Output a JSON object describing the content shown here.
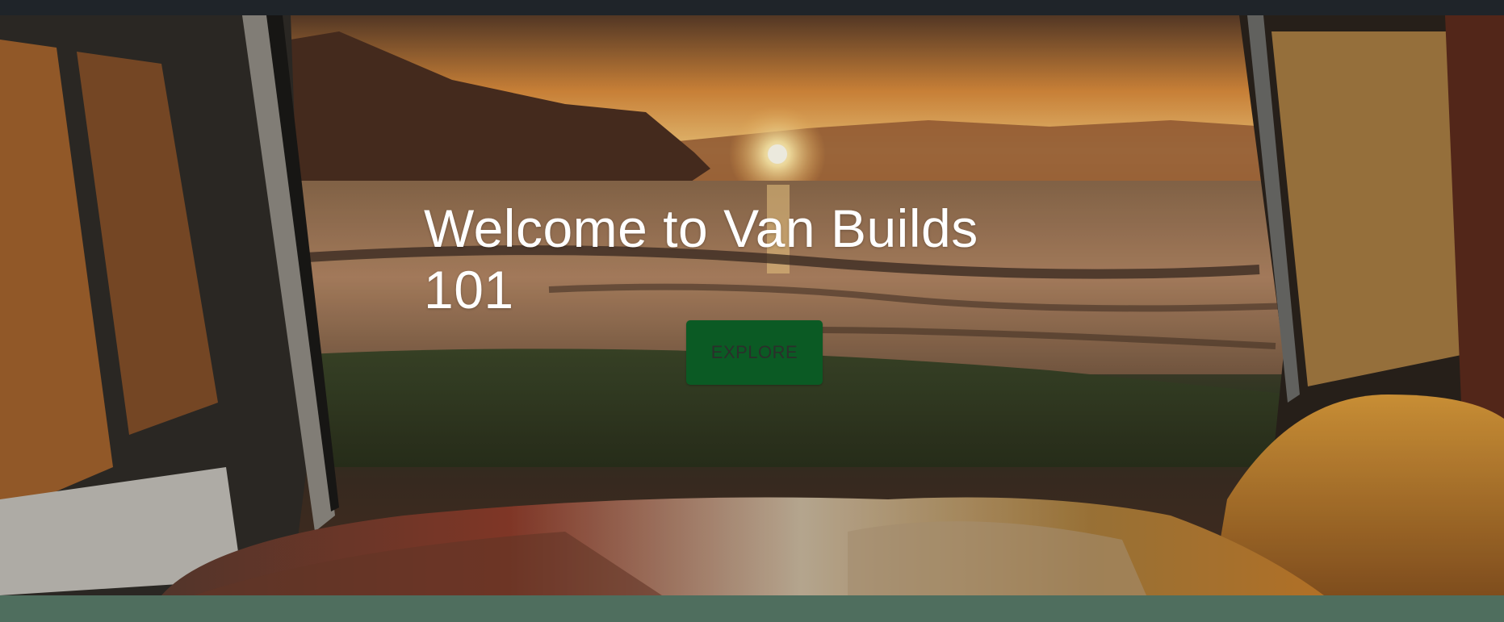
{
  "hero": {
    "title": "Welcome to Van Builds 101",
    "cta_label": "EXPLORE",
    "background_image": "sunset-ocean-view-from-van-interior"
  },
  "colors": {
    "top_bar": "#1f2429",
    "cta_background": "#0b5a24",
    "cta_text": "#2b2f2b",
    "title_text": "#ffffff",
    "footer_band": "#4f6e5e"
  }
}
